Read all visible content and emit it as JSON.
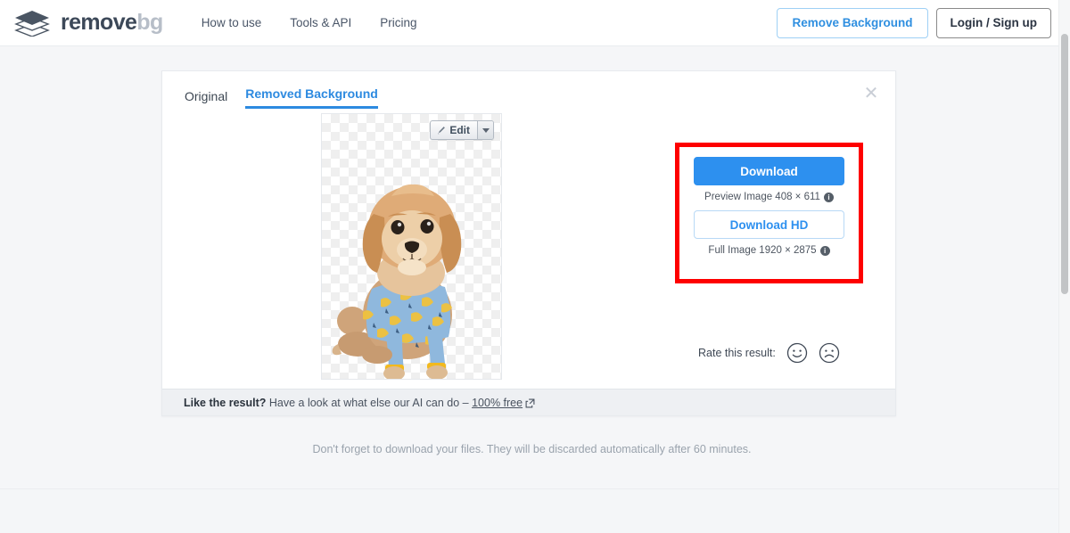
{
  "header": {
    "logo_icon": "layers-diamond-icon",
    "brand_primary": "remove",
    "brand_secondary": "bg",
    "nav": [
      {
        "label": "How to use"
      },
      {
        "label": "Tools & API"
      },
      {
        "label": "Pricing"
      }
    ],
    "remove_bg_button": "Remove Background",
    "login_button": "Login / Sign up"
  },
  "card": {
    "tabs": [
      {
        "label": "Original",
        "active": false
      },
      {
        "label": "Removed Background",
        "active": true
      }
    ],
    "close_icon": "close-icon",
    "edit_button": {
      "label": "Edit",
      "icon": "brush-icon",
      "dropdown_icon": "chevron-down-icon"
    },
    "image": {
      "alt": "Shih Tzu dog wearing blue and yellow banana-print pajamas on transparent checkerboard background",
      "background": "transparency-checkerboard"
    },
    "download_panel": {
      "highlight_color": "#fe0000",
      "download_button": "Download",
      "download_caption": "Preview Image 408 × 611",
      "download_hd_button": "Download HD",
      "download_hd_caption": "Full Image 1920 × 2875",
      "info_icon": "info-icon",
      "preview_width": 408,
      "preview_height": 611,
      "full_width": 1920,
      "full_height": 2875
    },
    "rate": {
      "label": "Rate this result:",
      "positive_icon": "smiley-face-icon",
      "negative_icon": "frowning-face-icon"
    },
    "footer": {
      "bold_text": "Like the result?",
      "text": " Have a look at what else our AI can do – ",
      "link_text": "100% free",
      "external_icon": "external-link-icon"
    }
  },
  "notice": "Don't forget to download your files. They will be discarded automatically after 60 minutes.",
  "scrollbar": {
    "name": "vertical-scrollbar"
  },
  "colors": {
    "accent_blue": "#2d90ef",
    "brand_dark": "#3c4858",
    "brand_light": "#b7bec8",
    "highlight_red": "#fe0000"
  }
}
